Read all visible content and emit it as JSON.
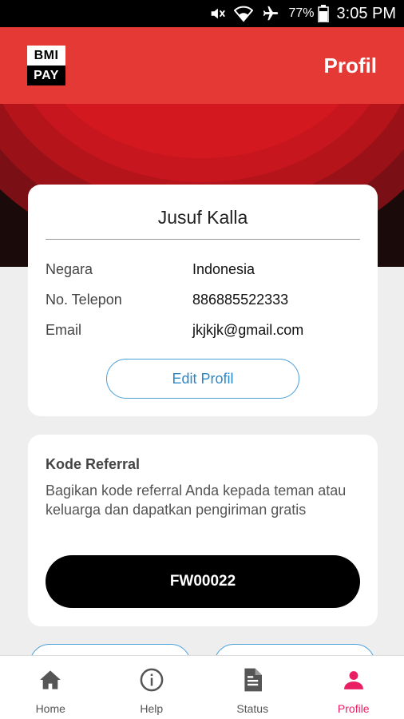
{
  "status_bar": {
    "battery": "77%",
    "time": "3:05 PM",
    "icons": [
      "mute-icon",
      "wifi-icon",
      "airplane-icon",
      "battery-icon"
    ]
  },
  "app_bar": {
    "logo_top": "BMI",
    "logo_bottom": "PAY",
    "title": "Profil",
    "color": "#e53935"
  },
  "profile": {
    "name": "Jusuf Kalla",
    "rows": [
      {
        "label": "Negara",
        "value": "Indonesia"
      },
      {
        "label": "No. Telepon",
        "value": "886885522333"
      },
      {
        "label": "Email",
        "value": "jkjkjk@gmail.com"
      }
    ],
    "edit_label": "Edit Profil"
  },
  "referral": {
    "title": "Kode Referral",
    "description": "Bagikan kode referral Anda kepada teman atau keluarga dan dapatkan pengiriman gratis",
    "code": "FW00022"
  },
  "bottom_nav": {
    "items": [
      {
        "label": "Home",
        "icon": "home-icon"
      },
      {
        "label": "Help",
        "icon": "info-icon"
      },
      {
        "label": "Status",
        "icon": "document-icon"
      },
      {
        "label": "Profile",
        "icon": "person-icon",
        "active": true
      }
    ],
    "active_color": "#e91e63"
  }
}
